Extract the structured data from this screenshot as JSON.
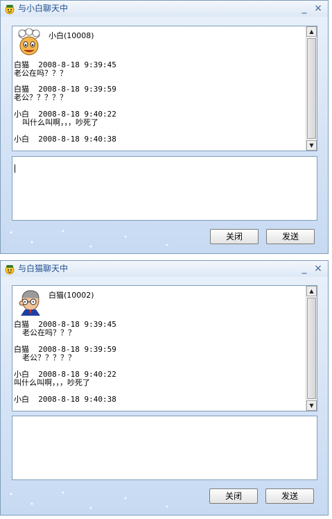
{
  "windows": [
    {
      "title": "与小白聊天中",
      "contact": "小白(10008)",
      "messages": [
        {
          "sender": "白猫",
          "time": "2008-8-18 9:39:45",
          "text": "老公在吗？？？"
        },
        {
          "sender": "白猫",
          "time": "2008-8-18 9:39:59",
          "text": "老公？？？？？"
        },
        {
          "sender": "小白",
          "time": "2008-8-18 9:40:22",
          "text": "叫什么叫啊，，，吵死了"
        },
        {
          "sender": "小白",
          "time": "2008-8-18 9:40:38",
          "text": ""
        }
      ],
      "input_value": "",
      "buttons": {
        "close": "关闭",
        "send": "发送"
      },
      "title_buttons": {
        "minimize": "_",
        "close": "×"
      }
    },
    {
      "title": "与白猫聊天中",
      "contact": "白猫(10002)",
      "messages": [
        {
          "sender": "白猫",
          "time": "2008-8-18 9:39:45",
          "text": "老公在吗？？？"
        },
        {
          "sender": "白猫",
          "time": "2008-8-18 9:39:59",
          "text": "老公？？？？？"
        },
        {
          "sender": "小白",
          "time": "2008-8-18 9:40:22",
          "text": "叫什么叫啊，，，吵死了"
        },
        {
          "sender": "小白",
          "time": "2008-8-18 9:40:38",
          "text": ""
        }
      ],
      "input_value": "",
      "buttons": {
        "close": "关闭",
        "send": "发送"
      },
      "title_buttons": {
        "minimize": "_",
        "close": "×"
      }
    }
  ],
  "icons": {
    "app": "smiley-app-icon",
    "avatar1": "chef-avatar-icon",
    "avatar2": "old-man-avatar-icon",
    "scroll_up": "scroll-up-arrow-icon",
    "scroll_down": "scroll-down-arrow-icon"
  }
}
